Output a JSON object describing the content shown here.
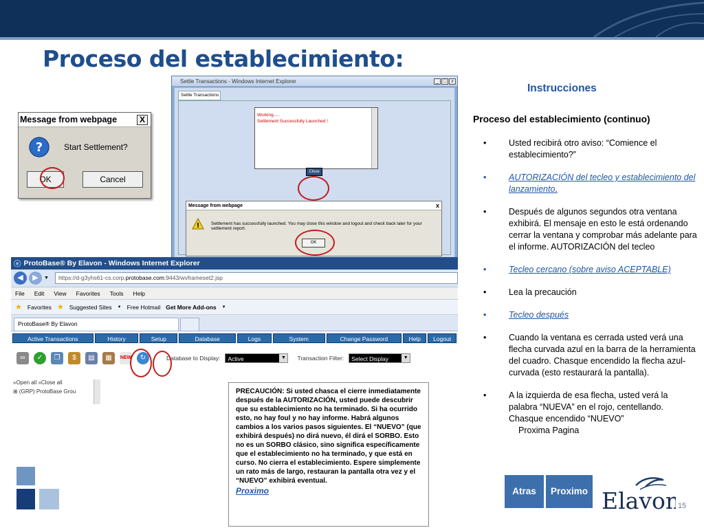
{
  "slide": {
    "title": "Proceso del establecimiento:",
    "page_number": "15"
  },
  "msgbox1": {
    "title": "Message from webpage",
    "close": "X",
    "message": "Start Settlement?",
    "ok_label": "OK",
    "cancel_label": "Cancel"
  },
  "settle_window": {
    "title": "Settle Transactions - Windows Internet Explorer",
    "tab_label": "Settle Transactions",
    "log_line1": "Working.....",
    "log_line2": "Settlement Successfully Launched !",
    "close_label": "Close"
  },
  "msgbox2": {
    "title": "Message from webpage",
    "close": "x",
    "message": "Settlement has successfully launched. You may close this window and logout and check back later for your settlement report.",
    "ok_label": "OK"
  },
  "browser": {
    "title": "ProtoBase® By Elavon - Windows Internet Explorer",
    "url_prefix": "https://d-g3yhs61-cs.corp.",
    "url_domain": "protobase.com",
    "url_suffix": ":9443/wvframeset2.jsp",
    "menu": [
      "File",
      "Edit",
      "View",
      "Favorites",
      "Tools",
      "Help"
    ],
    "favorites_label": "Favorites",
    "suggested_sites": "Suggested Sites",
    "free_hotmail": "Free Hotmail",
    "get_more_addons": "Get More Add-ons",
    "tab_label": "ProtoBase® By Elavon",
    "nav_items": [
      "Active Transactions",
      "History",
      "Setup",
      "Database",
      "Logs",
      "System",
      "Change Password",
      "Help",
      "Logout"
    ],
    "db_label": "Database to Display:",
    "db_value": "Active",
    "filter_label": "Transaction Filter:",
    "filter_value": "Select Display",
    "new_icon_text": "NEW",
    "tree_line1": "»Open all  »Close all",
    "tree_line2": "⊞  (GRP) ProtoBase Grou"
  },
  "instructions": {
    "heading": "Instrucciones",
    "subheading": "Proceso del establecimiento (continuo)",
    "b1": "Usted recibirá otro aviso: “Comience el establecimiento?”",
    "b2_link": "AUTORIZACIÓN del tecleo y establecimiento del lanzamiento",
    "b2_tail": ".",
    "b3": "Después de algunos segundos otra ventana exhibirá. El mensaje en esto le está ordenando cerrar la ventana y comprobar más adelante para el informe. AUTORIZACIÓN del tecleo",
    "b4_link": "Tecleo cercano (sobre aviso ACEPTABLE)",
    "b5": "Lea la precaución",
    "b6_link": "Tecleo después",
    "b7": "Cuando la ventana es cerrada usted verá una flecha curvada azul en la barra de la herramienta del cuadro. Chasque encendido la flecha azul-curvada (esto restaurará la pantalla).",
    "b8": "A la izquierda de esa flecha, usted verá la palabra “NUEVA” en el rojo, centellando. Chasque encendido “NUEVO”",
    "b8_tail": "Proxima Pagina"
  },
  "caution": {
    "text": "PRECAUCIÓN: Si usted chasca el cierre inmediatamente después de la AUTORIZACIÓN, usted puede descubrir que su establecimiento no ha terminado. Si ha ocurrido esto, no hay foul y no hay informe. Habrá algunos cambios a los varios pasos siguientes. El “NUEVO” (que exhibirá después) no dirá nuevo, él dirá el SORBO. Esto no es un SORBO clásico, sino significa específicamente que el establecimiento no ha terminado, y que está en curso. No cierra el establecimiento. Espere simplemente un rato más de largo, restauran la pantalla otra vez y el “NUEVO” exhibirá eventual.",
    "link": "Proximo"
  },
  "nav": {
    "prev": "Atras",
    "next": "Proximo"
  },
  "logo": {
    "text": "Elavon"
  },
  "colors": {
    "banner": "#0f3059",
    "title": "#1f4e8c",
    "accent": "#1f55a5",
    "nav_button": "#3d6fad",
    "highlight_circle": "#c21b1b"
  }
}
